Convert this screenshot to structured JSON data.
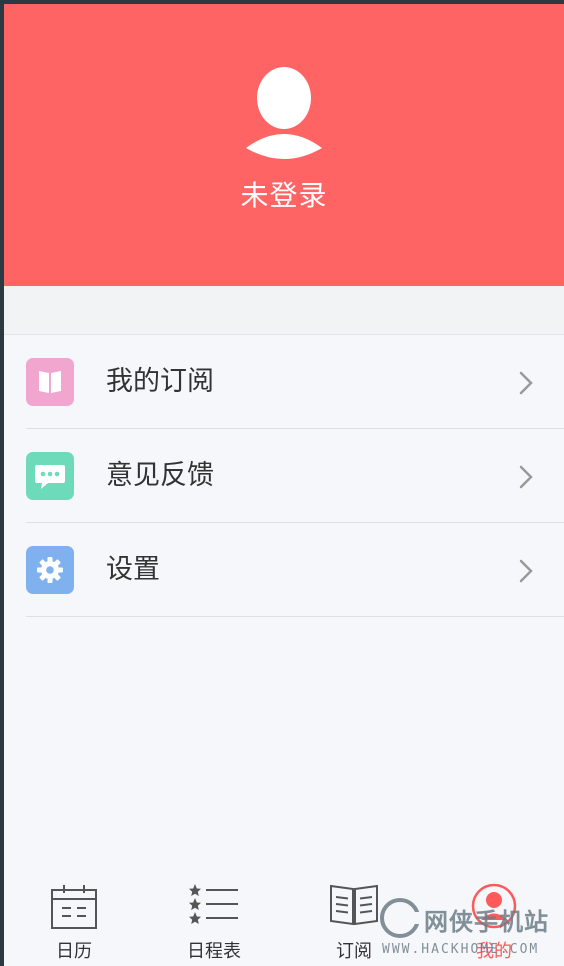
{
  "profile": {
    "status_text": "未登录"
  },
  "menu": [
    {
      "label": "我的订阅",
      "icon": "book-icon",
      "color": "#f0a6cf"
    },
    {
      "label": "意见反馈",
      "icon": "chat-bubble-icon",
      "color": "#6ddbb9"
    },
    {
      "label": "设置",
      "icon": "gear-icon",
      "color": "#7fb1ef"
    }
  ],
  "tabbar": {
    "tabs": [
      {
        "label": "日历",
        "icon": "calendar-icon"
      },
      {
        "label": "日程表",
        "icon": "starred-list-icon"
      },
      {
        "label": "订阅",
        "icon": "open-book-icon"
      },
      {
        "label": "我的",
        "icon": "person-icon",
        "active": true
      }
    ]
  },
  "watermark": {
    "text": "网侠手机站",
    "url": "WWW.HACKHOME.COM"
  },
  "colors": {
    "header": "#ff6465",
    "active_tab": "#ff5a5a"
  }
}
